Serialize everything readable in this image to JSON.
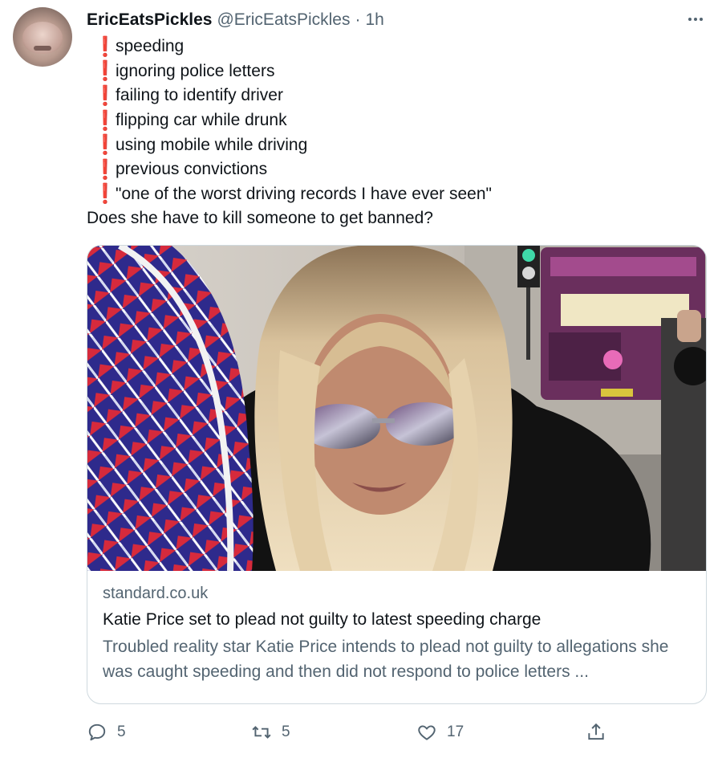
{
  "tweet": {
    "display_name": "EricEatsPickles",
    "handle": "@EricEatsPickles",
    "separator": "·",
    "time": "1h",
    "bullet_mark": "❗",
    "bullets": [
      "speeding",
      "ignoring police letters",
      "failing to identify driver",
      "flipping car while drunk",
      "using mobile while driving",
      "previous convictions",
      "\"one of the worst driving records I have ever seen\""
    ],
    "question": "Does she have to kill someone to get banned?"
  },
  "card": {
    "domain": "standard.co.uk",
    "title": "Katie Price set to plead not guilty to latest speeding charge",
    "description": "Troubled reality star Katie Price intends to plead not guilty to allegations she was caught speeding and then did not respond to police letters ..."
  },
  "actions": {
    "reply_count": "5",
    "retweet_count": "5",
    "like_count": "17"
  },
  "icons": {
    "more": "more-horizontal-icon",
    "reply": "reply-icon",
    "retweet": "retweet-icon",
    "like": "heart-icon",
    "share": "share-icon"
  },
  "colors": {
    "text_primary": "#0f1419",
    "text_secondary": "#536471",
    "border": "#cfd9de",
    "bullet_red": "#c4262e"
  }
}
